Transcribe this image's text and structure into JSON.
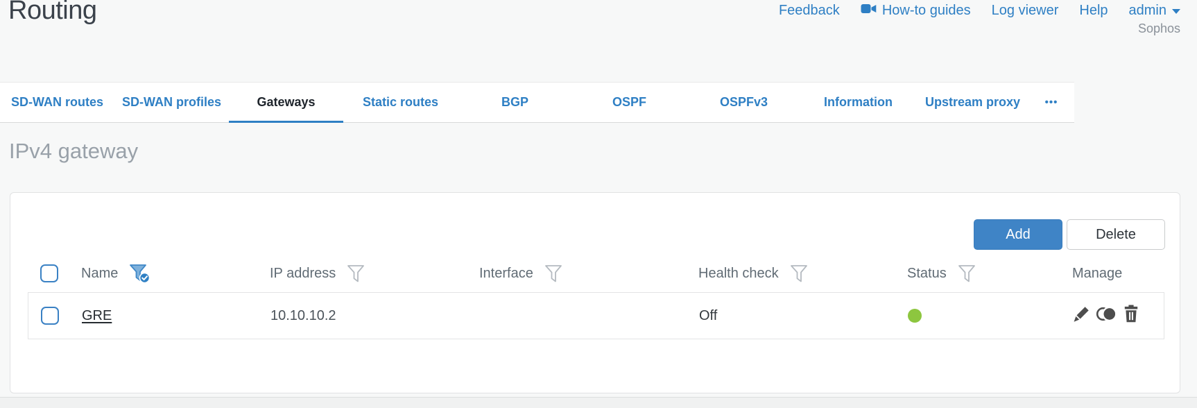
{
  "header": {
    "title": "Routing",
    "nav": {
      "feedback": "Feedback",
      "howto_guides": "How-to guides",
      "log_viewer": "Log viewer",
      "help": "Help",
      "user": "admin",
      "brand": "Sophos"
    }
  },
  "tabs": {
    "active": "Gateways",
    "items": [
      {
        "label": "SD-WAN routes"
      },
      {
        "label": "SD-WAN profiles"
      },
      {
        "label": "Gateways"
      },
      {
        "label": "Static routes"
      },
      {
        "label": "BGP"
      },
      {
        "label": "OSPF"
      },
      {
        "label": "OSPFv3"
      },
      {
        "label": "Information"
      },
      {
        "label": "Upstream proxy"
      }
    ],
    "more": "•••"
  },
  "section": {
    "title": "IPv4 gateway"
  },
  "toolbar": {
    "add": "Add",
    "delete": "Delete"
  },
  "table": {
    "columns": [
      {
        "label": "Name",
        "filter": "active"
      },
      {
        "label": "IP address",
        "filter": "available"
      },
      {
        "label": "Interface",
        "filter": "available"
      },
      {
        "label": "Health check",
        "filter": "available"
      },
      {
        "label": "Status",
        "filter": "available"
      },
      {
        "label": "Manage",
        "filter": "none"
      }
    ],
    "rows": [
      {
        "name": "GRE",
        "ip_address": "10.10.10.2",
        "interface": "",
        "health_check": "Off",
        "status": "green",
        "manage_actions": [
          "edit",
          "clone",
          "delete"
        ]
      }
    ]
  },
  "colors": {
    "accent_blue": "#2e7fc4",
    "status_green": "#8dc63f"
  }
}
